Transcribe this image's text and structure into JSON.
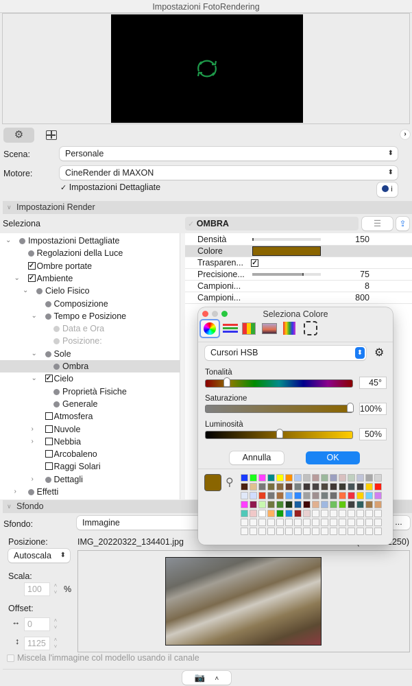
{
  "window": {
    "title": "Impostazioni FotoRendering"
  },
  "tabs": [
    {
      "name": "settings",
      "icon": "gear-icon"
    },
    {
      "name": "layout",
      "icon": "layout-icon"
    }
  ],
  "scene": {
    "label": "Scena:",
    "value": "Personale"
  },
  "engine": {
    "label": "Motore:",
    "value": "CineRender di MAXON"
  },
  "detailed": {
    "label": "Impostazioni Dettagliate",
    "checked": true
  },
  "render_section": {
    "title": "Impostazioni Render"
  },
  "select_row": {
    "label": "Seleziona",
    "current": "OMBRA"
  },
  "tree": [
    {
      "label": "Impostazioni Dettagliate",
      "level": 0,
      "chev": "down",
      "mark": "bullet"
    },
    {
      "label": "Regolazioni della Luce",
      "level": 1,
      "chev": "",
      "mark": "bullet"
    },
    {
      "label": "Ombre portate",
      "level": 1,
      "chev": "",
      "mark": "checked"
    },
    {
      "label": "Ambiente",
      "level": 1,
      "chev": "down",
      "mark": "checked"
    },
    {
      "label": "Cielo Fisico",
      "level": 2,
      "chev": "down",
      "mark": "bullet"
    },
    {
      "label": "Composizione",
      "level": 3,
      "chev": "",
      "mark": "bullet"
    },
    {
      "label": "Tempo e Posizione",
      "level": 3,
      "chev": "down",
      "mark": "bullet"
    },
    {
      "label": "Data e Ora",
      "level": 4,
      "chev": "",
      "mark": "dim"
    },
    {
      "label": "Posizione:",
      "level": 4,
      "chev": "",
      "mark": "dim"
    },
    {
      "label": "Sole",
      "level": 3,
      "chev": "down",
      "mark": "bullet"
    },
    {
      "label": "Ombra",
      "level": 4,
      "chev": "",
      "mark": "bullet",
      "selected": true
    },
    {
      "label": "Cielo",
      "level": 3,
      "chev": "down",
      "mark": "checked"
    },
    {
      "label": "Proprietà Fisiche",
      "level": 4,
      "chev": "",
      "mark": "bullet"
    },
    {
      "label": "Generale",
      "level": 4,
      "chev": "",
      "mark": "bullet"
    },
    {
      "label": "Atmosfera",
      "level": 3,
      "chev": "",
      "mark": "unchecked"
    },
    {
      "label": "Nuvole",
      "level": 3,
      "chev": "right",
      "mark": "unchecked"
    },
    {
      "label": "Nebbia",
      "level": 3,
      "chev": "right",
      "mark": "unchecked"
    },
    {
      "label": "Arcobaleno",
      "level": 3,
      "chev": "",
      "mark": "unchecked"
    },
    {
      "label": "Raggi Solari",
      "level": 3,
      "chev": "",
      "mark": "unchecked"
    },
    {
      "label": "Dettagli",
      "level": 3,
      "chev": "right",
      "mark": "bullet"
    },
    {
      "label": "Effetti",
      "level": 1,
      "chev": "right",
      "mark": "bullet"
    }
  ],
  "properties": [
    {
      "label": "Densità",
      "type": "slider",
      "fraction": 0.0,
      "value": "150"
    },
    {
      "label": "Colore",
      "type": "color",
      "color": "#8a6500",
      "selected": true
    },
    {
      "label": "Trasparen...",
      "type": "checkbox",
      "checked": true
    },
    {
      "label": "Precisione...",
      "type": "slider",
      "fraction": 0.75,
      "value": "75"
    },
    {
      "label": "Campioni...",
      "type": "text",
      "value": "8"
    },
    {
      "label": "Campioni...",
      "type": "text",
      "value": "800"
    }
  ],
  "color_picker": {
    "title": "Seleziona Colore",
    "mode": "Cursori HSB",
    "hue": {
      "label": "Tonalità",
      "value": "45°",
      "fraction": 0.125
    },
    "saturation": {
      "label": "Saturazione",
      "value": "100%",
      "fraction": 1.0
    },
    "brightness": {
      "label": "Luminosità",
      "value": "50%",
      "fraction": 0.5
    },
    "cancel": "Annulla",
    "ok": "OK",
    "current_color": "#8a6500",
    "swatches": [
      "#1a3cff",
      "#1aff1a",
      "#ff40ff",
      "#008b8b",
      "#ffff00",
      "#ff9000",
      "#b0c8f0",
      "#c0c0c0",
      "#b89c9c",
      "#9cb89c",
      "#9ca0c0",
      "#d8c0c0",
      "#c0d0c0",
      "#c0c4d8",
      "#a8a8a8",
      "#d4d4d4",
      "#4a2010",
      "#e0c090",
      "#787878",
      "#787040",
      "#8a6a40",
      "#6a4030",
      "#788080",
      "#403838",
      "#484444",
      "#504840",
      "#403834",
      "#3c3c34",
      "#485458",
      "#403c3c",
      "#ffd000",
      "#ff2010",
      "#e0e8f8",
      "#d0dcff",
      "#e84020",
      "#787878",
      "#a87040",
      "#70b0ff",
      "#3088ff",
      "#a0a0a0",
      "#a09090",
      "#788080",
      "#707070",
      "#ff7040",
      "#f03040",
      "#ffd000",
      "#70d0ff",
      "#d080f0",
      "#ff40ff",
      "#901850",
      "#c8f8b0",
      "#707840",
      "#488830",
      "#203818",
      "#1860a0",
      "#400808",
      "#e0b090",
      "#a0b8e0",
      "#70c060",
      "#60c810",
      "#404040",
      "#306060",
      "#a07848",
      "#d8a070",
      "#50c8b8",
      "#f0c8c8",
      "#ffffff",
      "#ffb060",
      "#10a010",
      "#2088e8",
      "#982020",
      "#e8d0d0"
    ],
    "empty_slots": 40
  },
  "background_section": {
    "title": "Sfondo",
    "label": "Sfondo:",
    "value": "Immagine",
    "more": "...",
    "position_label": "Posizione:",
    "position_value": "Autoscala",
    "filename": "IMG_20220322_134401.jpg",
    "dimensions": "(4000 x 2250)",
    "scale_label": "Scala:",
    "scale_value": "100",
    "scale_unit": "%",
    "offset_label": "Offset:",
    "offset_x": "0",
    "offset_y": "1125",
    "blend_label": "Miscela l'immagine col modello usando il canale"
  }
}
